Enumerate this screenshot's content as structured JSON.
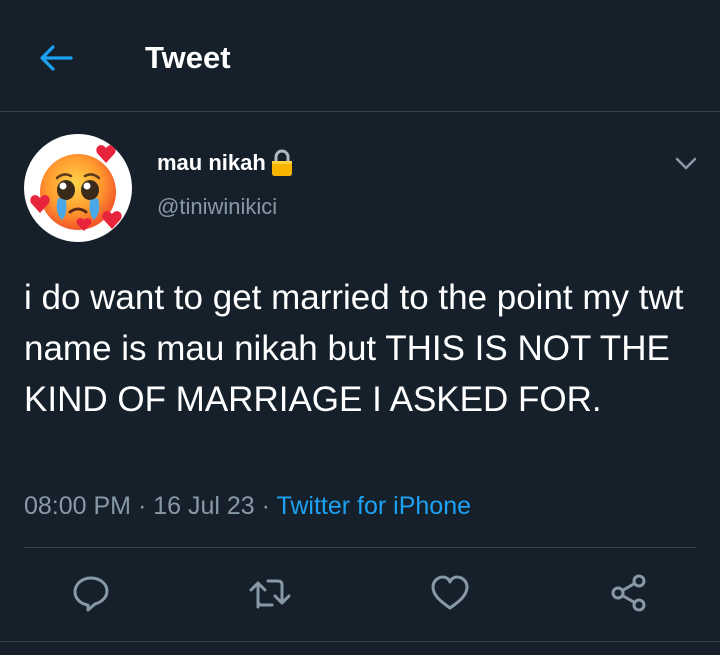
{
  "header": {
    "title": "Tweet",
    "back_icon": "back-arrow-icon"
  },
  "author": {
    "display_name": "mau nikah",
    "handle": "@tiniwinikici",
    "protected_icon": "lock-icon",
    "avatar": "pleading-face-with-hearts-emoji"
  },
  "tweet": {
    "text": "i do want to get married to the point my twt name is mau nikah but THIS IS NOT THE KIND OF MARRIAGE I ASKED FOR.",
    "time": "08:00 PM",
    "separator": " · ",
    "date": "16 Jul 23",
    "source": "Twitter for iPhone"
  },
  "actions": [
    "reply-icon",
    "retweet-icon",
    "like-icon",
    "share-icon"
  ],
  "colors": {
    "background": "#15202b",
    "border": "#38444d",
    "secondary_text": "#8899a6",
    "accent": "#1da1f2"
  }
}
